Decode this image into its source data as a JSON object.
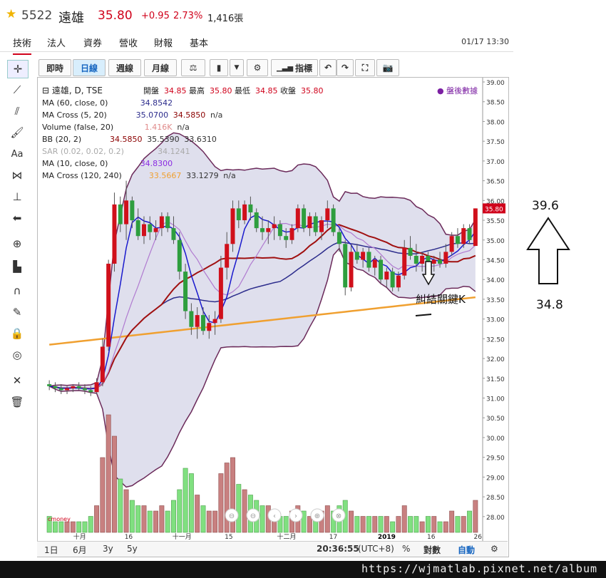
{
  "header": {
    "code": "5522",
    "name": "遠雄",
    "price": "35.80",
    "change": "+0.95",
    "percent": "2.73%",
    "volume": "1,416張",
    "star_color": "#f0b400",
    "up_color": "#d0021b"
  },
  "tabs": [
    "技術",
    "法人",
    "資券",
    "營收",
    "財報",
    "基本"
  ],
  "datetime": "01/17 13:30",
  "toolbar": {
    "buttons": [
      "即時",
      "日線",
      "週線",
      "月線",
      "指標"
    ],
    "icons": [
      "scale-icon",
      "candlestick-icon",
      "dropdown-icon",
      "gear-icon",
      "indicator-icon",
      "undo-icon",
      "redo-icon",
      "fullscreen-icon",
      "camera-icon"
    ]
  },
  "left_tools": [
    "crosshair-icon",
    "line-icon",
    "fib-icon",
    "brush-icon",
    "text-icon",
    "pattern-icon",
    "measure-icon",
    "arrow-icon",
    "zoom-icon",
    "ruler-icon",
    "magnet-icon",
    "edit-icon",
    "lock-icon",
    "eye-icon",
    "tools-icon",
    "trash-icon"
  ],
  "legend": {
    "main": "遠雄, D, TSE",
    "ohlc": {
      "open_label": "開盤",
      "open": "34.85",
      "high_label": "最高",
      "high": "35.80",
      "low_label": "最低",
      "low": "34.85",
      "close_label": "收盤",
      "close": "35.80"
    },
    "after_hours": "盤後數據",
    "studies": [
      {
        "label": "MA (60, close, 0)",
        "values": [
          "34.8542"
        ],
        "colors": [
          "#2c2c8c"
        ]
      },
      {
        "label": "MA Cross (5, 20)",
        "values": [
          "35.0700",
          "34.5850",
          "n/a"
        ],
        "colors": [
          "#2c2c8c",
          "#8b0000",
          "#333333"
        ]
      },
      {
        "label": "Volume (false, 20)",
        "values": [
          "1.416K",
          "n/a"
        ],
        "colors": [
          "#e08a8a",
          "#333333"
        ]
      },
      {
        "label": "BB (20, 2)",
        "values": [
          "34.5850",
          "35.5390",
          "33.6310"
        ],
        "colors": [
          "#8b0000",
          "#333333",
          "#333333"
        ]
      },
      {
        "label": "SAR (0.02, 0.02, 0.2)",
        "values": [
          "34.1241"
        ],
        "colors": [
          "#aaaaaa"
        ]
      },
      {
        "label": "MA (10, close, 0)",
        "values": [
          "34.8300"
        ],
        "colors": [
          "#8a2be2"
        ]
      },
      {
        "label": "MA Cross (120, 240)",
        "values": [
          "33.5667",
          "33.1279",
          "n/a"
        ],
        "colors": [
          "#f0a030",
          "#333333",
          "#333333"
        ]
      }
    ]
  },
  "price_axis": {
    "ticks": [
      "39.00",
      "38.50",
      "38.00",
      "37.50",
      "37.00",
      "36.50",
      "36.00",
      "35.50",
      "35.00",
      "34.50",
      "34.00",
      "33.50",
      "33.00",
      "32.50",
      "32.00",
      "31.50",
      "31.00",
      "30.50",
      "30.00",
      "29.50",
      "29.00",
      "28.50",
      "28.00"
    ],
    "last_price": "35.80",
    "last_price_color": "#d0021b"
  },
  "time_axis": {
    "labels": [
      "十月",
      "16",
      "十一月",
      "15",
      "十二月",
      "17",
      "2019",
      "16",
      "26"
    ]
  },
  "chart_data": {
    "type": "candlestick",
    "title": "遠雄, D, TSE",
    "ylim": [
      27.6,
      39.0
    ],
    "ohlc": [
      {
        "o": 31.35,
        "h": 31.45,
        "l": 31.2,
        "c": 31.3
      },
      {
        "o": 31.3,
        "h": 31.4,
        "l": 31.15,
        "c": 31.25
      },
      {
        "o": 31.25,
        "h": 31.35,
        "l": 31.1,
        "c": 31.2
      },
      {
        "o": 31.2,
        "h": 31.3,
        "l": 31.1,
        "c": 31.25
      },
      {
        "o": 31.25,
        "h": 31.35,
        "l": 31.15,
        "c": 31.3
      },
      {
        "o": 31.3,
        "h": 31.4,
        "l": 31.2,
        "c": 31.25
      },
      {
        "o": 31.25,
        "h": 31.35,
        "l": 31.1,
        "c": 31.2
      },
      {
        "o": 31.2,
        "h": 31.3,
        "l": 31.05,
        "c": 31.15
      },
      {
        "o": 31.15,
        "h": 31.5,
        "l": 31.1,
        "c": 31.4
      },
      {
        "o": 31.4,
        "h": 32.5,
        "l": 31.3,
        "c": 32.3
      },
      {
        "o": 32.3,
        "h": 34.5,
        "l": 32.2,
        "c": 34.4
      },
      {
        "o": 34.4,
        "h": 36.2,
        "l": 34.2,
        "c": 35.9
      },
      {
        "o": 35.9,
        "h": 36.1,
        "l": 35.2,
        "c": 35.4
      },
      {
        "o": 35.4,
        "h": 36.5,
        "l": 35.0,
        "c": 36.0
      },
      {
        "o": 36.0,
        "h": 36.1,
        "l": 35.3,
        "c": 35.5
      },
      {
        "o": 35.5,
        "h": 35.8,
        "l": 35.0,
        "c": 35.1
      },
      {
        "o": 35.1,
        "h": 35.6,
        "l": 34.9,
        "c": 35.4
      },
      {
        "o": 35.4,
        "h": 35.6,
        "l": 35.0,
        "c": 35.2
      },
      {
        "o": 35.2,
        "h": 35.5,
        "l": 35.0,
        "c": 35.3
      },
      {
        "o": 35.3,
        "h": 35.7,
        "l": 35.1,
        "c": 35.6
      },
      {
        "o": 35.6,
        "h": 35.7,
        "l": 35.2,
        "c": 35.3
      },
      {
        "o": 35.3,
        "h": 35.6,
        "l": 34.9,
        "c": 35.0
      },
      {
        "o": 35.0,
        "h": 35.2,
        "l": 34.0,
        "c": 34.2
      },
      {
        "o": 34.2,
        "h": 34.4,
        "l": 33.0,
        "c": 33.2
      },
      {
        "o": 33.2,
        "h": 33.4,
        "l": 32.6,
        "c": 32.8
      },
      {
        "o": 32.8,
        "h": 33.3,
        "l": 32.5,
        "c": 33.1
      },
      {
        "o": 33.1,
        "h": 33.3,
        "l": 32.6,
        "c": 32.7
      },
      {
        "o": 32.7,
        "h": 33.1,
        "l": 32.5,
        "c": 32.9
      },
      {
        "o": 32.9,
        "h": 33.2,
        "l": 32.6,
        "c": 33.0
      },
      {
        "o": 33.0,
        "h": 34.6,
        "l": 32.9,
        "c": 34.3
      },
      {
        "o": 34.3,
        "h": 35.2,
        "l": 34.0,
        "c": 34.9
      },
      {
        "o": 34.9,
        "h": 36.0,
        "l": 34.7,
        "c": 35.8
      },
      {
        "o": 35.8,
        "h": 36.0,
        "l": 35.3,
        "c": 35.5
      },
      {
        "o": 35.5,
        "h": 36.0,
        "l": 35.4,
        "c": 35.9
      },
      {
        "o": 35.9,
        "h": 36.1,
        "l": 35.5,
        "c": 35.7
      },
      {
        "o": 35.7,
        "h": 35.8,
        "l": 35.2,
        "c": 35.3
      },
      {
        "o": 35.3,
        "h": 35.6,
        "l": 35.0,
        "c": 35.2
      },
      {
        "o": 35.2,
        "h": 35.5,
        "l": 34.9,
        "c": 35.3
      },
      {
        "o": 35.3,
        "h": 35.6,
        "l": 35.0,
        "c": 35.4
      },
      {
        "o": 35.4,
        "h": 35.5,
        "l": 35.0,
        "c": 35.1
      },
      {
        "o": 35.1,
        "h": 35.3,
        "l": 34.8,
        "c": 35.0
      },
      {
        "o": 35.0,
        "h": 35.4,
        "l": 34.9,
        "c": 35.3
      },
      {
        "o": 35.3,
        "h": 35.9,
        "l": 35.2,
        "c": 35.8
      },
      {
        "o": 35.8,
        "h": 35.9,
        "l": 35.2,
        "c": 35.3
      },
      {
        "o": 35.3,
        "h": 35.7,
        "l": 35.1,
        "c": 35.6
      },
      {
        "o": 35.6,
        "h": 35.7,
        "l": 35.1,
        "c": 35.2
      },
      {
        "o": 35.2,
        "h": 35.6,
        "l": 35.0,
        "c": 35.5
      },
      {
        "o": 35.5,
        "h": 36.0,
        "l": 35.3,
        "c": 35.8
      },
      {
        "o": 35.8,
        "h": 35.9,
        "l": 35.1,
        "c": 35.2
      },
      {
        "o": 35.2,
        "h": 35.3,
        "l": 34.7,
        "c": 34.9
      },
      {
        "o": 34.9,
        "h": 35.0,
        "l": 33.6,
        "c": 33.8
      },
      {
        "o": 33.8,
        "h": 34.9,
        "l": 33.7,
        "c": 34.7
      },
      {
        "o": 34.7,
        "h": 34.9,
        "l": 34.4,
        "c": 34.5
      },
      {
        "o": 34.5,
        "h": 34.8,
        "l": 34.3,
        "c": 34.7
      },
      {
        "o": 34.7,
        "h": 34.8,
        "l": 34.2,
        "c": 34.3
      },
      {
        "o": 34.3,
        "h": 34.6,
        "l": 34.1,
        "c": 34.5
      },
      {
        "o": 34.5,
        "h": 34.6,
        "l": 33.9,
        "c": 34.0
      },
      {
        "o": 34.0,
        "h": 34.3,
        "l": 33.8,
        "c": 34.2
      },
      {
        "o": 34.2,
        "h": 34.3,
        "l": 33.7,
        "c": 33.8
      },
      {
        "o": 33.8,
        "h": 34.2,
        "l": 33.7,
        "c": 34.1
      },
      {
        "o": 34.1,
        "h": 35.0,
        "l": 34.0,
        "c": 34.8
      },
      {
        "o": 34.8,
        "h": 35.1,
        "l": 34.5,
        "c": 34.6
      },
      {
        "o": 34.6,
        "h": 34.9,
        "l": 34.2,
        "c": 34.4
      },
      {
        "o": 34.4,
        "h": 34.7,
        "l": 34.2,
        "c": 34.6
      },
      {
        "o": 34.6,
        "h": 34.7,
        "l": 34.3,
        "c": 34.4
      },
      {
        "o": 34.4,
        "h": 34.6,
        "l": 34.2,
        "c": 34.5
      },
      {
        "o": 34.5,
        "h": 34.7,
        "l": 34.3,
        "c": 34.4
      },
      {
        "o": 34.4,
        "h": 34.9,
        "l": 34.3,
        "c": 34.7
      },
      {
        "o": 34.7,
        "h": 35.2,
        "l": 34.6,
        "c": 35.1
      },
      {
        "o": 35.1,
        "h": 35.3,
        "l": 34.8,
        "c": 34.9
      },
      {
        "o": 34.9,
        "h": 35.4,
        "l": 34.8,
        "c": 35.3
      },
      {
        "o": 35.3,
        "h": 35.4,
        "l": 34.9,
        "c": 35.0
      },
      {
        "o": 34.85,
        "h": 35.8,
        "l": 34.85,
        "c": 35.8
      }
    ],
    "volume": [
      3,
      2,
      2,
      2,
      2,
      2,
      2,
      3,
      5,
      14,
      22,
      18,
      10,
      8,
      6,
      5,
      5,
      4,
      4,
      5,
      4,
      6,
      8,
      12,
      11,
      7,
      5,
      4,
      4,
      11,
      13,
      14,
      9,
      8,
      7,
      6,
      5,
      5,
      4,
      3,
      3,
      4,
      5,
      4,
      3,
      3,
      4,
      5,
      4,
      5,
      6,
      4,
      3,
      3,
      3,
      3,
      3,
      3,
      2,
      3,
      5,
      3,
      3,
      2,
      3,
      3,
      2,
      2,
      4,
      3,
      3,
      4,
      6
    ],
    "series": [
      {
        "name": "MA (60, close, 0)",
        "color": "#2c2c8c"
      },
      {
        "name": "MA Cross (5, 20)",
        "color": "#1a1acd"
      },
      {
        "name": "MA Cross (120, 240)",
        "color": "#f0a030"
      },
      {
        "name": "BB (20, 2)",
        "color": "#6b2a5a"
      },
      {
        "name": "MA (10, close, 0)",
        "color": "#b07ad0"
      }
    ]
  },
  "bottom_bar": {
    "ranges": [
      "1日",
      "6月",
      "3y",
      "5y"
    ],
    "clock": "20:36:55",
    "timezone": "(UTC+8)",
    "percent": "%",
    "log": "對數",
    "auto": "自動"
  },
  "logo_text": "cmoney\n拓墣網",
  "annotations": {
    "target_high": "39.6",
    "target_low": "34.8",
    "key_k": "糾結關鍵K"
  },
  "footer_url": "https://wjmatlab.pixnet.net/album"
}
